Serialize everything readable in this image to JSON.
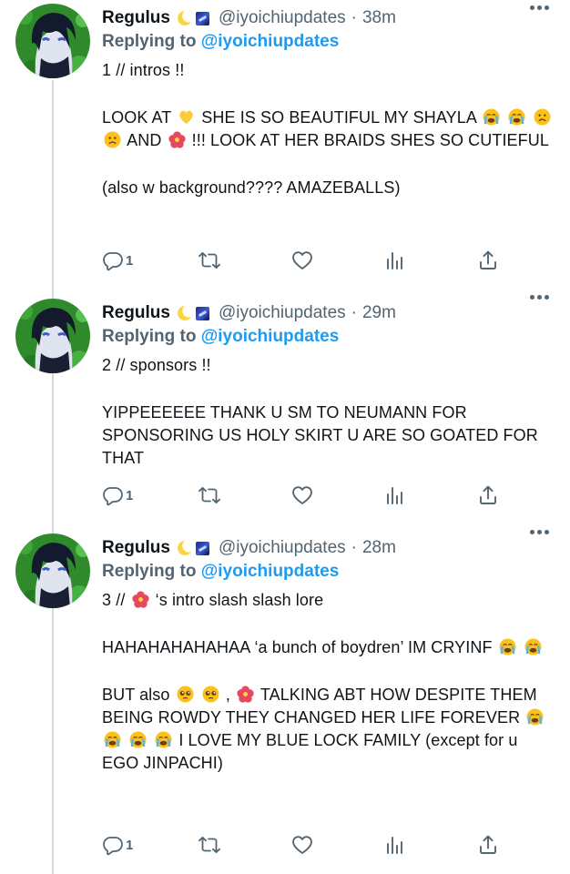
{
  "colors": {
    "link": "#1d9bf0",
    "muted": "#536471",
    "text": "#0f1419",
    "line": "#cfd9de"
  },
  "tweets": [
    {
      "name": "Regulus",
      "handle": "@iyoichiupdates",
      "time": "38m",
      "reply_prefix": "Replying to",
      "reply_handle": "@iyoichiupdates",
      "line1": "1 // intros !!",
      "p2_a": "LOOK AT",
      "p2_b": "SHE IS SO BEAUTIFUL MY SHAYLA",
      "p2_c": "AND",
      "p2_d": "!!! LOOK AT HER BRAIDS SHES SO CUTIEFUL",
      "p3": "(also w background???? AMAZEBALLS)",
      "reply_count": "1",
      "icons": [
        "yellow-heart-emoji",
        "loudly-crying-emoji",
        "loudly-crying-emoji",
        "frowning-emoji",
        "frowning-emoji",
        "hibiscus-emoji"
      ]
    },
    {
      "name": "Regulus",
      "handle": "@iyoichiupdates",
      "time": "29m",
      "reply_prefix": "Replying to",
      "reply_handle": "@iyoichiupdates",
      "line1": "2 // sponsors !!",
      "p2": "YIPPEEEEEE THANK U SM TO NEUMANN FOR SPONSORING US HOLY SKIRT U ARE SO GOATED FOR THAT",
      "reply_count": "1"
    },
    {
      "name": "Regulus",
      "handle": "@iyoichiupdates",
      "time": "28m",
      "reply_prefix": "Replying to",
      "reply_handle": "@iyoichiupdates",
      "line1_a": "3 //",
      "line1_b": "‘s intro slash slash lore",
      "p2": "HAHAHAHAHAHAA ‘a bunch of boydren’ IM CRYINF",
      "p3_a": "BUT also",
      "p3_b": ",",
      "p3_c": "TALKING ABT HOW DESPITE THEM BEING ROWDY THEY CHANGED HER LIFE FOREVER",
      "p3_d": "I LOVE MY BLUE LOCK FAMILY (except for u EGO JINPACHI)",
      "reply_count": "1",
      "icons": [
        "hibiscus-emoji",
        "loudly-crying-emoji",
        "pleading-face-emoji",
        "hibiscus-emoji"
      ]
    }
  ],
  "action_icons": [
    "reply-icon",
    "retweet-icon",
    "like-icon",
    "analytics-icon",
    "share-icon"
  ]
}
